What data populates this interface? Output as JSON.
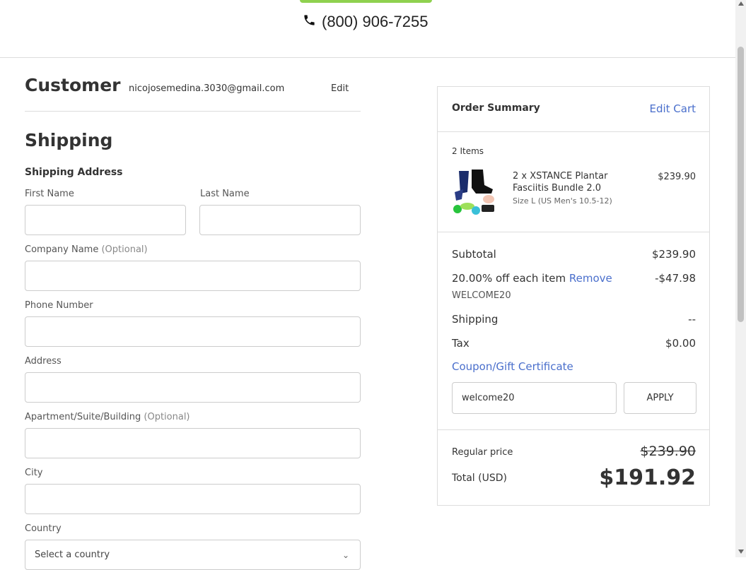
{
  "header": {
    "phone": "(800) 906-7255"
  },
  "customer": {
    "title": "Customer",
    "email": "nicojosemedina.3030@gmail.com",
    "edit_label": "Edit"
  },
  "shipping": {
    "title": "Shipping",
    "address_title": "Shipping Address",
    "fields": {
      "first_name": {
        "label": "First Name"
      },
      "last_name": {
        "label": "Last Name"
      },
      "company": {
        "label": "Company Name",
        "optional": "(Optional)"
      },
      "phone": {
        "label": "Phone Number"
      },
      "address": {
        "label": "Address"
      },
      "apartment": {
        "label": "Apartment/Suite/Building",
        "optional": "(Optional)"
      },
      "city": {
        "label": "City"
      },
      "country": {
        "label": "Country",
        "value": "Select a country"
      }
    }
  },
  "order_summary": {
    "title": "Order Summary",
    "edit_cart": "Edit Cart",
    "items_count": "2 Items",
    "item": {
      "name": "2 x XSTANCE Plantar Fasciitis Bundle 2.0",
      "size": "Size L (US Men's 10.5-12)",
      "price": "$239.90"
    },
    "subtotal_label": "Subtotal",
    "subtotal_value": "$239.90",
    "discount_label": "20.00% off each item",
    "discount_remove": "Remove",
    "discount_value": "-$47.98",
    "discount_code": "WELCOME20",
    "shipping_label": "Shipping",
    "shipping_value": "--",
    "tax_label": "Tax",
    "tax_value": "$0.00",
    "coupon_link": "Coupon/Gift Certificate",
    "coupon_value": "welcome20",
    "apply_label": "APPLY",
    "regular_label": "Regular price",
    "regular_value": "$239.90",
    "total_label": "Total (USD)",
    "total_value": "$191.92"
  },
  "icons": {
    "phone": "phone-icon",
    "chevron": "chevron-down-icon"
  },
  "colors": {
    "accent": "#4a6fcc",
    "logo_strip": "#8fd14f",
    "border": "#cccccc"
  }
}
